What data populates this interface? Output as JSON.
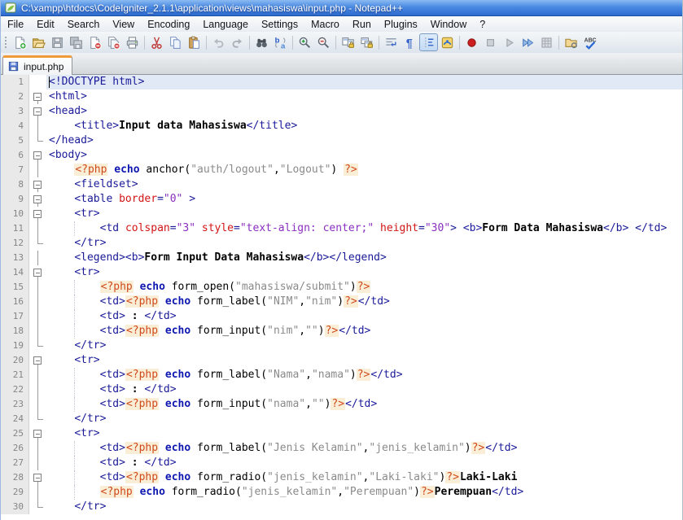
{
  "window": {
    "title": "C:\\xampp\\htdocs\\CodeIgniter_2.1.1\\application\\views\\mahasiswa\\input.php - Notepad++"
  },
  "colors": {
    "title_bar": "#2d6bd0",
    "tab_accent": "#ef9b3c",
    "current_line_bg": "#e1e9f6",
    "tag": "#1a1a99",
    "attribute": "#d21515",
    "attribute_value": "#8a2fc0",
    "php_delimiter": "#cf4a1d",
    "php_delimiter_bg": "#fbeed6",
    "keyword": "#0d17b0",
    "string": "#8a8a8a",
    "line_number": "#858585"
  },
  "menu": {
    "items": [
      "File",
      "Edit",
      "Search",
      "View",
      "Encoding",
      "Language",
      "Settings",
      "Macro",
      "Run",
      "Plugins",
      "Window",
      "?"
    ]
  },
  "toolbar": {
    "items": [
      {
        "icon": "new-file"
      },
      {
        "icon": "open-file"
      },
      {
        "icon": "save-file",
        "disabled": true
      },
      {
        "icon": "save-all",
        "disabled": true
      },
      {
        "icon": "close-file"
      },
      {
        "icon": "close-all"
      },
      {
        "icon": "print"
      },
      {
        "sep": true
      },
      {
        "icon": "cut"
      },
      {
        "icon": "copy"
      },
      {
        "icon": "paste"
      },
      {
        "sep": true
      },
      {
        "icon": "undo",
        "disabled": true
      },
      {
        "icon": "redo",
        "disabled": true
      },
      {
        "sep": true
      },
      {
        "icon": "find"
      },
      {
        "icon": "replace"
      },
      {
        "sep": true
      },
      {
        "icon": "zoom-in"
      },
      {
        "icon": "zoom-out"
      },
      {
        "sep": true
      },
      {
        "icon": "sync-vertical"
      },
      {
        "icon": "sync-horizontal"
      },
      {
        "sep": true
      },
      {
        "icon": "word-wrap"
      },
      {
        "icon": "show-all-characters"
      },
      {
        "icon": "indent-guide",
        "pressed": true
      },
      {
        "icon": "user-language"
      },
      {
        "sep": true
      },
      {
        "icon": "record-macro"
      },
      {
        "icon": "stop-macro",
        "disabled": true
      },
      {
        "icon": "play-macro",
        "disabled": true
      },
      {
        "icon": "run-macro-multiple"
      },
      {
        "icon": "save-macro",
        "disabled": true
      },
      {
        "sep": true
      },
      {
        "icon": "doc-switcher"
      },
      {
        "icon": "spell-check"
      }
    ]
  },
  "tabs": [
    {
      "label": "input.php",
      "active": true,
      "icon": "floppy-blue"
    }
  ],
  "editor": {
    "lines": [
      {
        "n": 1,
        "f": "",
        "i": 0,
        "cur": true,
        "caret": true,
        "tk": [
          [
            "t",
            "<!DOCTYPE html>"
          ]
        ]
      },
      {
        "n": 2,
        "f": "m",
        "i": 0,
        "tk": [
          [
            "t",
            "<html>"
          ]
        ]
      },
      {
        "n": 3,
        "f": "m",
        "i": 0,
        "tk": [
          [
            "t",
            "<head>"
          ]
        ]
      },
      {
        "n": 4,
        "f": "l",
        "i": 4,
        "tk": [
          [
            "t",
            "<title>"
          ],
          [
            "b",
            "Input data Mahasiswa"
          ],
          [
            "t",
            "</title>"
          ]
        ]
      },
      {
        "n": 5,
        "f": "e",
        "i": 0,
        "tk": [
          [
            "t",
            "</head>"
          ]
        ]
      },
      {
        "n": 6,
        "f": "m",
        "i": 0,
        "tk": [
          [
            "t",
            "<body>"
          ]
        ]
      },
      {
        "n": 7,
        "f": "l",
        "i": 4,
        "tk": [
          [
            "p",
            "<?php"
          ],
          [
            "n",
            " "
          ],
          [
            "k",
            "echo"
          ],
          [
            "n",
            " anchor("
          ],
          [
            "s",
            "\"auth/logout\""
          ],
          [
            "n",
            ","
          ],
          [
            "s",
            "\"Logout\""
          ],
          [
            "n",
            ") "
          ],
          [
            "p",
            "?>"
          ]
        ]
      },
      {
        "n": 8,
        "f": "m",
        "i": 4,
        "tk": [
          [
            "t",
            "<fieldset>"
          ]
        ]
      },
      {
        "n": 9,
        "f": "m",
        "i": 4,
        "tk": [
          [
            "t",
            "<table "
          ],
          [
            "a",
            "border"
          ],
          [
            "t",
            "="
          ],
          [
            "v",
            "\"0\""
          ],
          [
            "t",
            " >"
          ]
        ]
      },
      {
        "n": 10,
        "f": "m",
        "i": 4,
        "tk": [
          [
            "t",
            "<tr>"
          ]
        ]
      },
      {
        "n": 11,
        "f": "l",
        "i": 8,
        "g": 1,
        "tk": [
          [
            "t",
            "<td "
          ],
          [
            "a",
            "colspan"
          ],
          [
            "t",
            "="
          ],
          [
            "v",
            "\"3\""
          ],
          [
            "n",
            " "
          ],
          [
            "a",
            "style"
          ],
          [
            "t",
            "="
          ],
          [
            "v",
            "\"text-align: center;\""
          ],
          [
            "n",
            " "
          ],
          [
            "a",
            "height"
          ],
          [
            "t",
            "="
          ],
          [
            "v",
            "\"30\""
          ],
          [
            "t",
            ">"
          ],
          [
            "n",
            " "
          ],
          [
            "t",
            "<b>"
          ],
          [
            "b",
            "Form Data Mahasiswa"
          ],
          [
            "t",
            "</b>"
          ],
          [
            "n",
            " "
          ],
          [
            "t",
            "</td>"
          ]
        ]
      },
      {
        "n": 12,
        "f": "e",
        "i": 4,
        "tk": [
          [
            "t",
            "</tr>"
          ]
        ]
      },
      {
        "n": 13,
        "f": "l",
        "i": 4,
        "tk": [
          [
            "t",
            "<legend><b>"
          ],
          [
            "b",
            "Form Input Data Mahasiswa"
          ],
          [
            "t",
            "</b></legend>"
          ]
        ]
      },
      {
        "n": 14,
        "f": "m",
        "i": 4,
        "tk": [
          [
            "t",
            "<tr>"
          ]
        ]
      },
      {
        "n": 15,
        "f": "l",
        "i": 8,
        "g": 1,
        "tk": [
          [
            "p",
            "<?php"
          ],
          [
            "n",
            " "
          ],
          [
            "k",
            "echo"
          ],
          [
            "n",
            " form_open("
          ],
          [
            "s",
            "\"mahasiswa/submit\""
          ],
          [
            "n",
            ")"
          ],
          [
            "p",
            "?>"
          ]
        ]
      },
      {
        "n": 16,
        "f": "l",
        "i": 8,
        "g": 1,
        "tk": [
          [
            "t",
            "<td>"
          ],
          [
            "p",
            "<?php"
          ],
          [
            "n",
            " "
          ],
          [
            "k",
            "echo"
          ],
          [
            "n",
            " form_label("
          ],
          [
            "s",
            "\"NIM\""
          ],
          [
            "n",
            ","
          ],
          [
            "s",
            "\"nim\""
          ],
          [
            "n",
            ")"
          ],
          [
            "p",
            "?>"
          ],
          [
            "t",
            "</td>"
          ]
        ]
      },
      {
        "n": 17,
        "f": "l",
        "i": 8,
        "g": 1,
        "tk": [
          [
            "t",
            "<td>"
          ],
          [
            "b",
            " : "
          ],
          [
            "t",
            "</td>"
          ]
        ]
      },
      {
        "n": 18,
        "f": "l",
        "i": 8,
        "g": 1,
        "tk": [
          [
            "t",
            "<td>"
          ],
          [
            "p",
            "<?php"
          ],
          [
            "n",
            " "
          ],
          [
            "k",
            "echo"
          ],
          [
            "n",
            " form_input("
          ],
          [
            "s",
            "\"nim\""
          ],
          [
            "n",
            ","
          ],
          [
            "s",
            "\"\""
          ],
          [
            "n",
            ")"
          ],
          [
            "p",
            "?>"
          ],
          [
            "t",
            "</td>"
          ]
        ]
      },
      {
        "n": 19,
        "f": "e",
        "i": 4,
        "tk": [
          [
            "t",
            "</tr>"
          ]
        ]
      },
      {
        "n": 20,
        "f": "m",
        "i": 4,
        "tk": [
          [
            "t",
            "<tr>"
          ]
        ]
      },
      {
        "n": 21,
        "f": "l",
        "i": 8,
        "g": 1,
        "tk": [
          [
            "t",
            "<td>"
          ],
          [
            "p",
            "<?php"
          ],
          [
            "n",
            " "
          ],
          [
            "k",
            "echo"
          ],
          [
            "n",
            " form_label("
          ],
          [
            "s",
            "\"Nama\""
          ],
          [
            "n",
            ","
          ],
          [
            "s",
            "\"nama\""
          ],
          [
            "n",
            ")"
          ],
          [
            "p",
            "?>"
          ],
          [
            "t",
            "</td>"
          ]
        ]
      },
      {
        "n": 22,
        "f": "l",
        "i": 8,
        "g": 1,
        "tk": [
          [
            "t",
            "<td>"
          ],
          [
            "b",
            " : "
          ],
          [
            "t",
            "</td>"
          ]
        ]
      },
      {
        "n": 23,
        "f": "l",
        "i": 8,
        "g": 1,
        "tk": [
          [
            "t",
            "<td>"
          ],
          [
            "p",
            "<?php"
          ],
          [
            "n",
            " "
          ],
          [
            "k",
            "echo"
          ],
          [
            "n",
            " form_input("
          ],
          [
            "s",
            "\"nama\""
          ],
          [
            "n",
            ","
          ],
          [
            "s",
            "\"\""
          ],
          [
            "n",
            ")"
          ],
          [
            "p",
            "?>"
          ],
          [
            "t",
            "</td>"
          ]
        ]
      },
      {
        "n": 24,
        "f": "e",
        "i": 4,
        "tk": [
          [
            "t",
            "</tr>"
          ]
        ]
      },
      {
        "n": 25,
        "f": "m",
        "i": 4,
        "tk": [
          [
            "t",
            "<tr>"
          ]
        ]
      },
      {
        "n": 26,
        "f": "l",
        "i": 8,
        "g": 1,
        "tk": [
          [
            "t",
            "<td>"
          ],
          [
            "p",
            "<?php"
          ],
          [
            "n",
            " "
          ],
          [
            "k",
            "echo"
          ],
          [
            "n",
            " form_label("
          ],
          [
            "s",
            "\"Jenis Kelamin\""
          ],
          [
            "n",
            ","
          ],
          [
            "s",
            "\"jenis_kelamin\""
          ],
          [
            "n",
            ")"
          ],
          [
            "p",
            "?>"
          ],
          [
            "t",
            "</td>"
          ]
        ]
      },
      {
        "n": 27,
        "f": "l",
        "i": 8,
        "g": 1,
        "tk": [
          [
            "t",
            "<td>"
          ],
          [
            "b",
            " : "
          ],
          [
            "t",
            "</td>"
          ]
        ]
      },
      {
        "n": 28,
        "f": "m",
        "i": 8,
        "g": 1,
        "tk": [
          [
            "t",
            "<td>"
          ],
          [
            "p",
            "<?php"
          ],
          [
            "n",
            " "
          ],
          [
            "k",
            "echo"
          ],
          [
            "n",
            " form_radio("
          ],
          [
            "s",
            "\"jenis_kelamin\""
          ],
          [
            "n",
            ","
          ],
          [
            "s",
            "\"Laki-laki\""
          ],
          [
            "n",
            ")"
          ],
          [
            "p",
            "?>"
          ],
          [
            "b",
            "Laki-Laki"
          ]
        ]
      },
      {
        "n": 29,
        "f": "l",
        "i": 8,
        "g": 1,
        "tk": [
          [
            "p",
            "<?php"
          ],
          [
            "n",
            " "
          ],
          [
            "k",
            "echo"
          ],
          [
            "n",
            " form_radio("
          ],
          [
            "s",
            "\"jenis_kelamin\""
          ],
          [
            "n",
            ","
          ],
          [
            "s",
            "\"Perempuan\""
          ],
          [
            "n",
            ")"
          ],
          [
            "p",
            "?>"
          ],
          [
            "b",
            "Perempuan"
          ],
          [
            "t",
            "</td>"
          ]
        ]
      },
      {
        "n": 30,
        "f": "e",
        "i": 4,
        "tk": [
          [
            "t",
            "</tr>"
          ]
        ]
      }
    ]
  }
}
